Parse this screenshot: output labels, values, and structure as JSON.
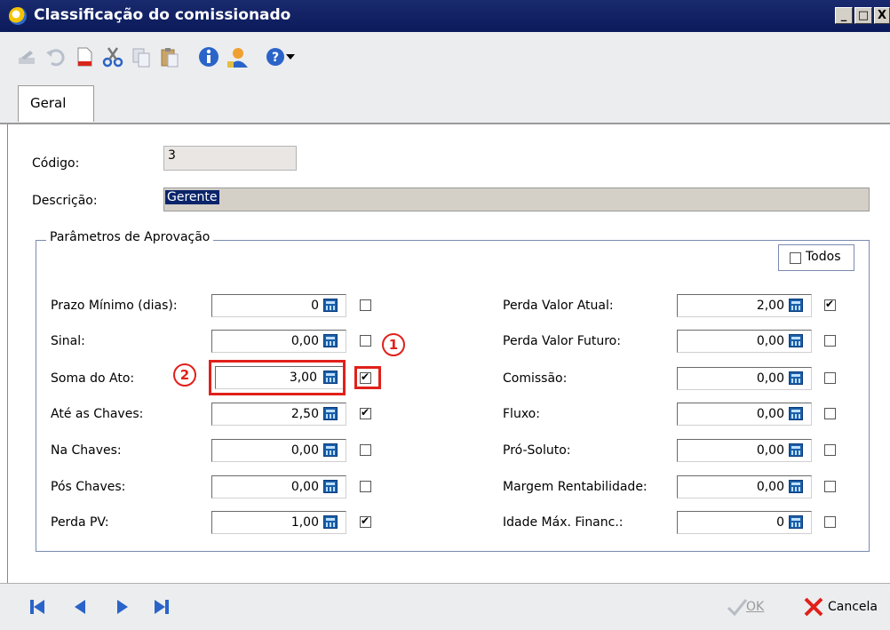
{
  "window": {
    "title": "Classificação do comissionado",
    "minimize": "_",
    "maximize": "□",
    "close": "X"
  },
  "tabs": [
    {
      "label": "Geral"
    }
  ],
  "form": {
    "codigo_label": "Código:",
    "codigo_value": "3",
    "descricao_label": "Descrição:",
    "descricao_value": "Gerente"
  },
  "group": {
    "title": "Parâmetros de Aprovação",
    "todos_label": "Todos",
    "left_rows": [
      {
        "label": "Prazo Mínimo (dias):",
        "value": "0",
        "checked": false
      },
      {
        "label": "Sinal:",
        "value": "0,00",
        "checked": false
      },
      {
        "label": "Soma do Ato:",
        "value": "3,00",
        "checked": true
      },
      {
        "label": "Até as Chaves:",
        "value": "2,50",
        "checked": true
      },
      {
        "label": "Na Chaves:",
        "value": "0,00",
        "checked": false
      },
      {
        "label": "Pós Chaves:",
        "value": "0,00",
        "checked": false
      },
      {
        "label": "Perda PV:",
        "value": "1,00",
        "checked": true
      }
    ],
    "right_rows": [
      {
        "label": "Perda Valor Atual:",
        "value": "2,00",
        "checked": true
      },
      {
        "label": "Perda Valor Futuro:",
        "value": "0,00",
        "checked": false
      },
      {
        "label": "Comissão:",
        "value": "0,00",
        "checked": false
      },
      {
        "label": "Fluxo:",
        "value": "0,00",
        "checked": false
      },
      {
        "label": "Pró-Soluto:",
        "value": "0,00",
        "checked": false
      },
      {
        "label": "Margem Rentabilidade:",
        "value": "0,00",
        "checked": false
      },
      {
        "label": "Idade Máx. Financ.:",
        "value": "0",
        "checked": false
      }
    ]
  },
  "annotations": {
    "badge_1": "1",
    "badge_2": "2"
  },
  "bottom": {
    "ok_label": "OK",
    "cancel_label": "Cancela"
  },
  "colors": {
    "title_bar": "#0a1a5a",
    "highlight": "#e1201a",
    "selection": "#0a246a"
  }
}
